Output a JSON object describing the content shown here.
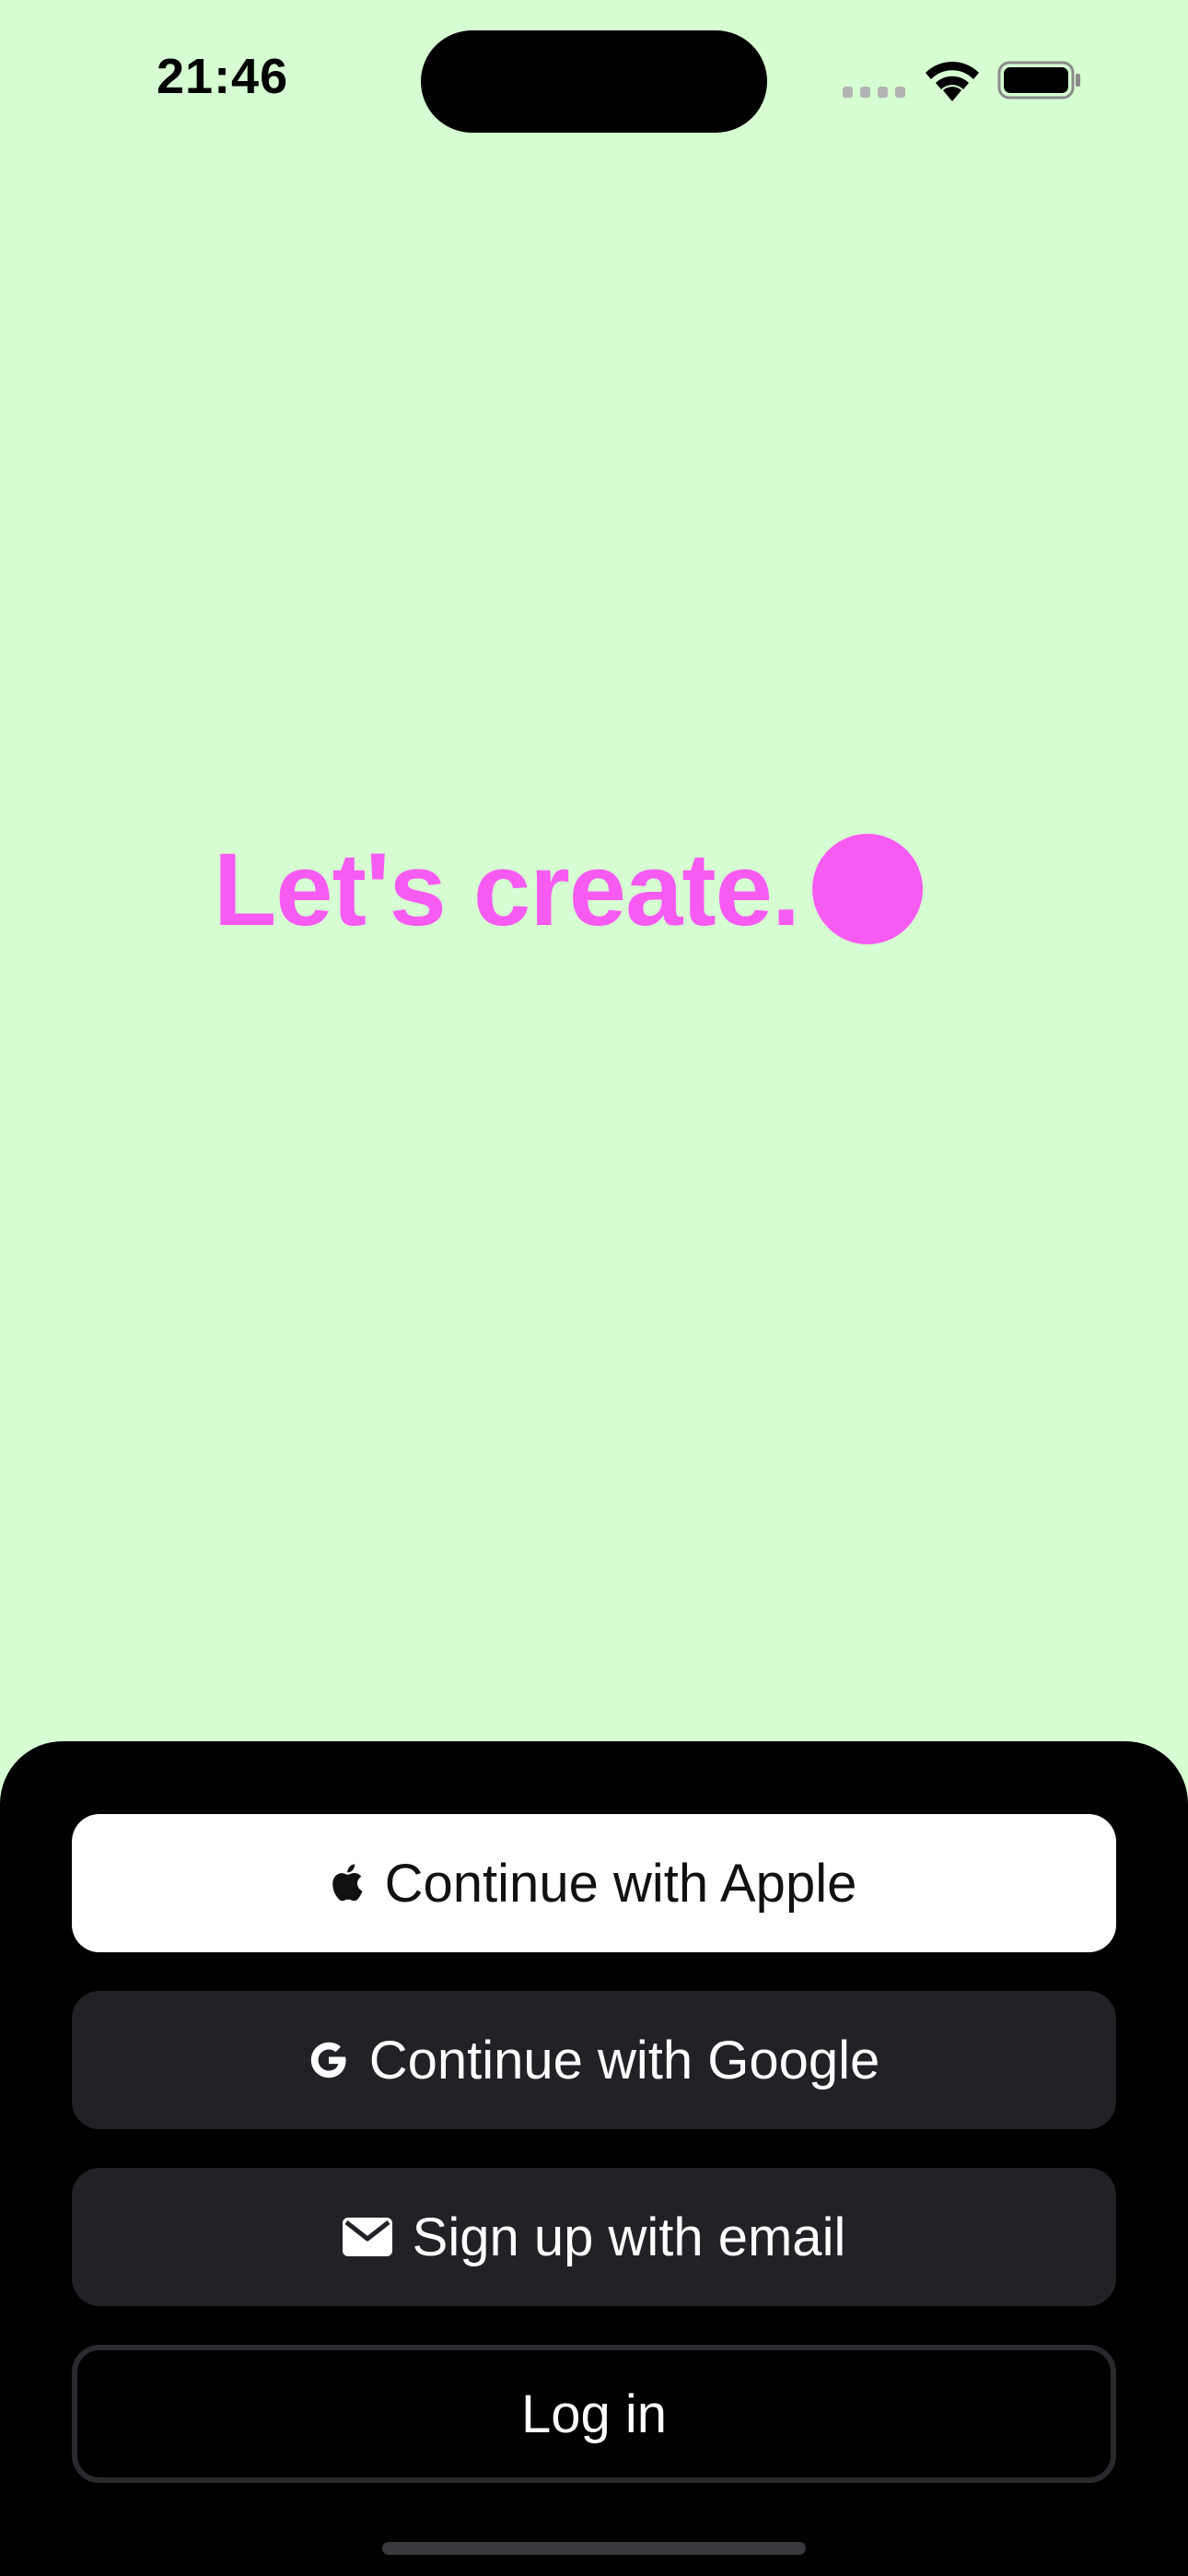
{
  "status_bar": {
    "time": "21:46"
  },
  "headline": {
    "text": "Let's create."
  },
  "auth": {
    "apple_label": "Continue with Apple",
    "google_label": "Continue with Google",
    "email_label": "Sign up with email",
    "login_label": "Log in"
  },
  "colors": {
    "background": "#d6fed2",
    "accent": "#f75bf2",
    "sheet": "#000000",
    "dark_button": "#232026",
    "light_button": "#ffffff"
  },
  "icons": {
    "apple": "apple-icon",
    "google": "google-icon",
    "email": "mail-icon",
    "wifi": "wifi-icon",
    "signal": "cellular-signal-icon",
    "battery": "battery-icon"
  }
}
